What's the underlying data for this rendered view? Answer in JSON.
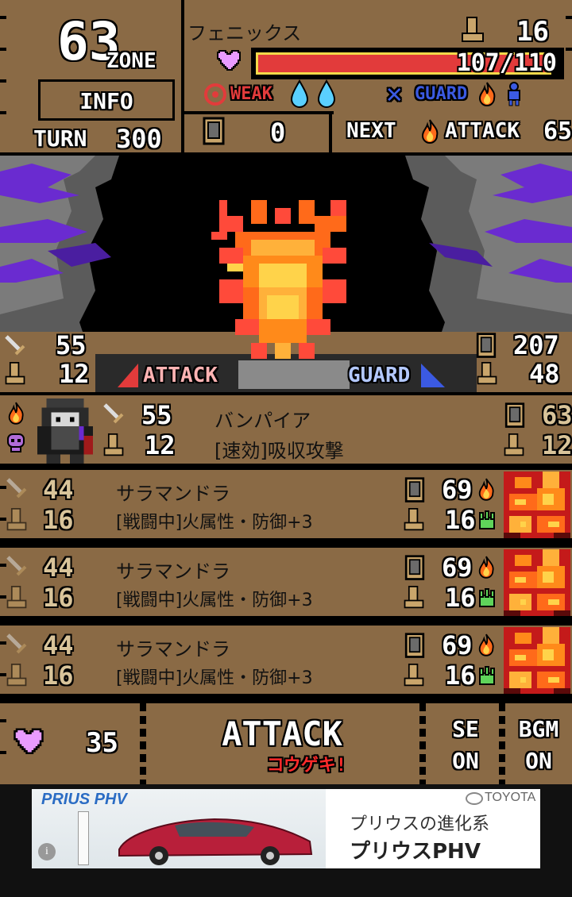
{
  "header": {
    "zone_number": "63",
    "zone_label": "ZONE",
    "info_label": "INFO",
    "turn_label": "TURN",
    "turn_value": "300",
    "enemy_name": "フェニックス",
    "boot_value": "16",
    "hp_current": "107",
    "hp_max": "110",
    "hp_fraction": 0.973,
    "weak_label": "WEAK",
    "guard_label": "GUARD",
    "shield_count": "0",
    "next_label": "NEXT",
    "next_action": "ATTACK",
    "next_value": "65"
  },
  "battle": {
    "left_attack": "55",
    "left_defense": "12",
    "right_shield": "207",
    "right_defense": "48",
    "attack_label": "ATTACK",
    "guard_label": "GUARD"
  },
  "leader": {
    "attack": "55",
    "defense": "12",
    "name": "バンパイア",
    "skill": "[速効]吸収攻撃",
    "shield": "63",
    "boot": "12"
  },
  "party": [
    {
      "atk": "44",
      "def": "16",
      "name": "サラマンドラ",
      "skill": "[戦闘中]火属性・防御+3",
      "shield": "69",
      "boot": "16"
    },
    {
      "atk": "44",
      "def": "16",
      "name": "サラマンドラ",
      "skill": "[戦闘中]火属性・防御+3",
      "shield": "69",
      "boot": "16"
    },
    {
      "atk": "44",
      "def": "16",
      "name": "サラマンドラ",
      "skill": "[戦闘中]火属性・防御+3",
      "shield": "69",
      "boot": "16"
    }
  ],
  "footer": {
    "hearts": "35",
    "attack_label": "ATTACK",
    "attack_sub": "コウゲキ!",
    "se_label": "SE",
    "se_state": "ON",
    "bgm_label": "BGM",
    "bgm_state": "ON"
  },
  "ad": {
    "brand_car": "PRIUS PHV",
    "brand": "TOYOTA",
    "line1": "プリウスの進化系",
    "line2": "プリウスPHV"
  },
  "colors": {
    "panel": "#8a6a45",
    "hp_bar": "#e23b3b",
    "weak": "#e23b3b",
    "guard": "#3b5ae2",
    "cream": "#fff2cc"
  }
}
